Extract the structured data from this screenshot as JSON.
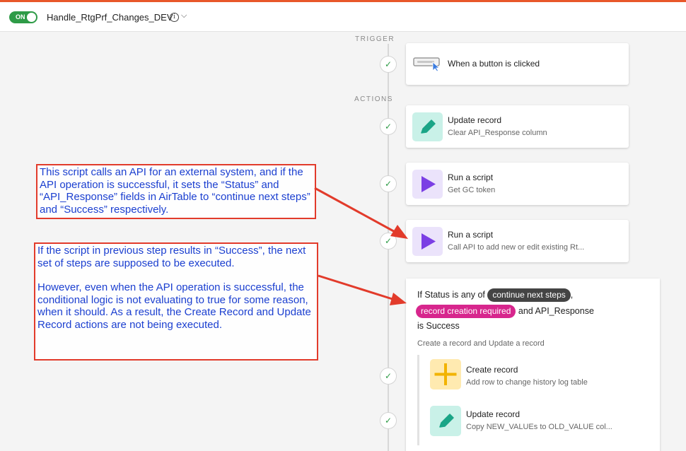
{
  "header": {
    "toggle_label": "ON",
    "automation_name": "Handle_RtgPrf_Changes_DEV",
    "info_glyph": "i",
    "chevron_glyph": "⌵"
  },
  "sections": {
    "trigger": "TRIGGER",
    "actions": "ACTIONS"
  },
  "check_glyph": "✓",
  "trigger": {
    "title": "When a button is clicked",
    "icon": "button-cursor-icon"
  },
  "steps": [
    {
      "title": "Update record",
      "subtitle": "Clear API_Response column",
      "icon": "pencil-icon",
      "color": "#c9f1e8"
    },
    {
      "title": "Run a script",
      "subtitle": "Get GC token",
      "icon": "play-icon",
      "color": "#ebe3fb"
    },
    {
      "title": "Run a script",
      "subtitle": "Call API to add new or edit existing Rt...",
      "icon": "play-icon",
      "color": "#ebe3fb"
    }
  ],
  "condition": {
    "prefix": "If Status is any of",
    "chip1": "continue next steps",
    "comma": ",",
    "chip2": "record creation required",
    "middle": "and API_Response",
    "tail": "is Success",
    "subtitle": "Create a record and Update a record",
    "chip1_color": "#444444",
    "chip2_color": "#d7268d"
  },
  "nested_actions": [
    {
      "title": "Create record",
      "subtitle": "Add row to change history log table",
      "icon": "plus-icon",
      "color": "#ffeab0"
    },
    {
      "title": "Update record",
      "subtitle": "Copy NEW_VALUEs to OLD_VALUE col...",
      "icon": "pencil-icon",
      "color": "#c9f1e8"
    }
  ],
  "annotations": {
    "first": "This script calls an API for an external system, and if the API operation is successful, it sets the “Status” and “API_Response” fields in AirTable to “continue next steps” and “Success” respectively.",
    "second_p1": "If the script in previous step results in “Success”, the next set of steps are supposed to be executed.",
    "second_p2": "However, even when the API operation is successful, the conditional logic is not evaluating to true for some reason, when it should. As a result, the Create Record and Update Record actions are not being executed."
  },
  "colors": {
    "toggle_on": "#2e9b47",
    "annotation_border": "#e23b2b",
    "annotation_text": "#1b3fd0",
    "accent_top": "#e8572a"
  }
}
